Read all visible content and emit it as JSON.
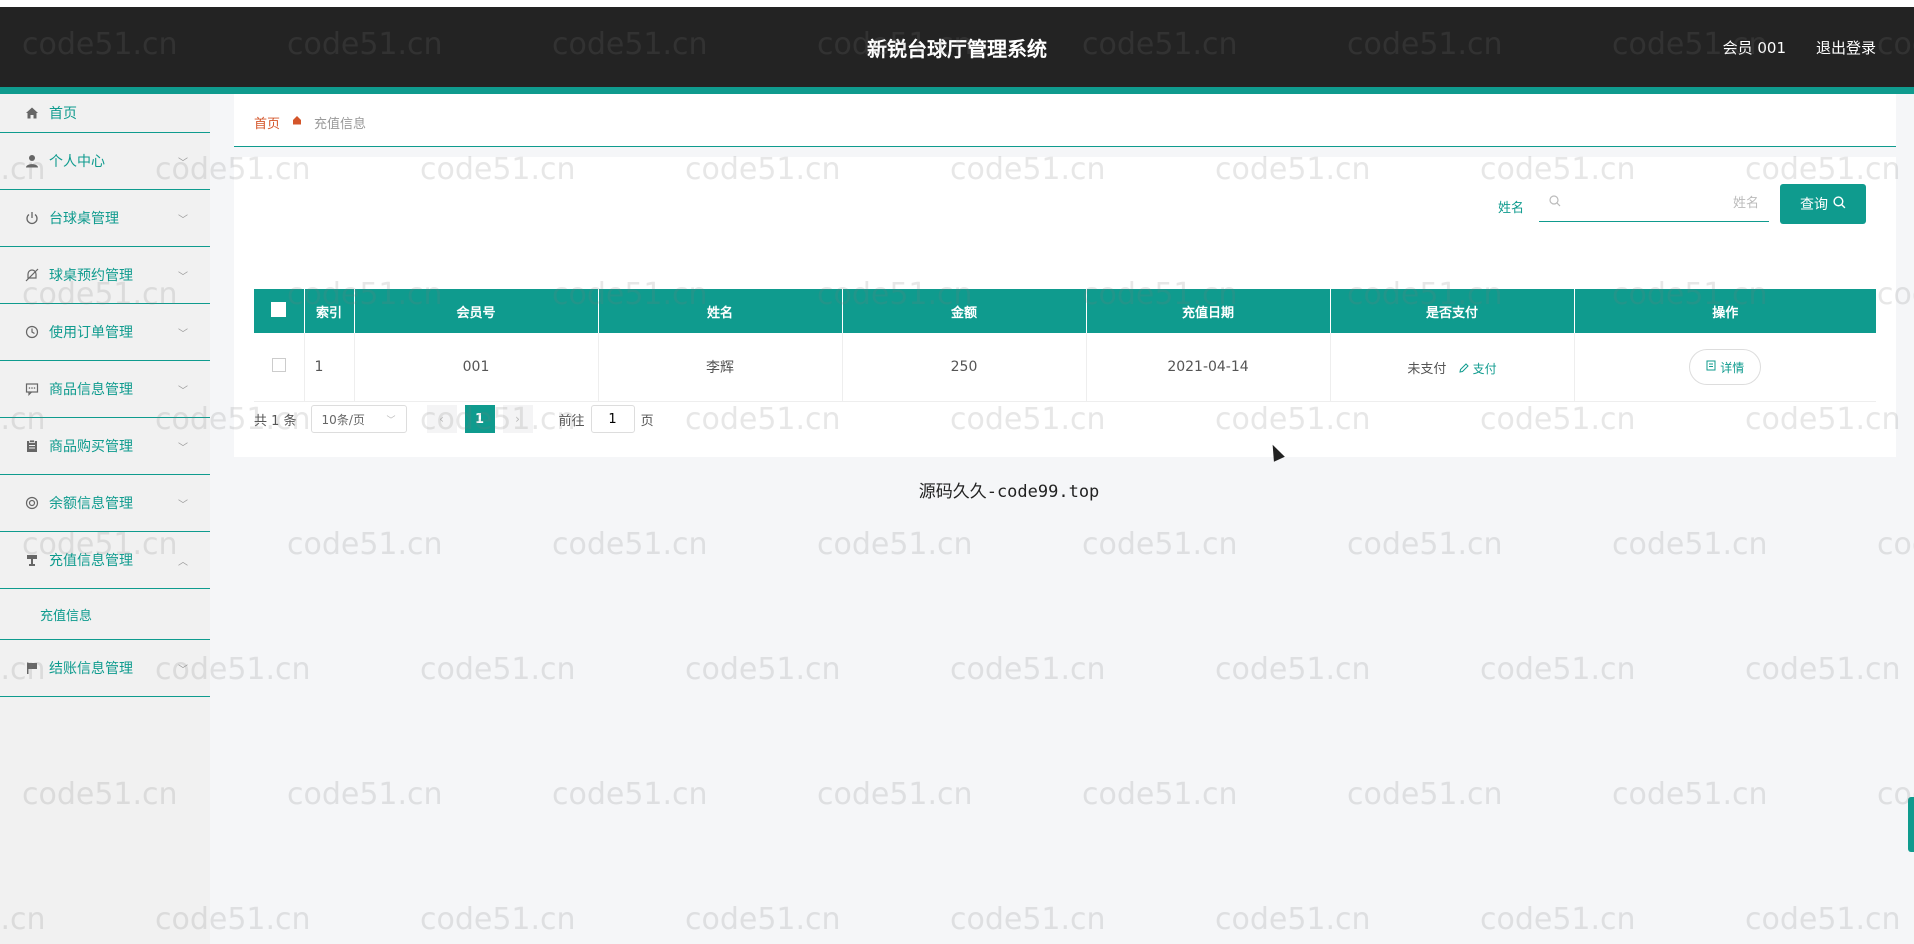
{
  "header": {
    "title": "新锐台球厅管理系统",
    "user": "会员 001",
    "logout": "退出登录"
  },
  "sidebar": {
    "items": [
      {
        "label": "首页",
        "icon": "home-icon"
      },
      {
        "label": "个人中心",
        "icon": "user-icon"
      },
      {
        "label": "台球桌管理",
        "icon": "power-icon"
      },
      {
        "label": "球桌预约管理",
        "icon": "bell-off-icon"
      },
      {
        "label": "使用订单管理",
        "icon": "clock-icon"
      },
      {
        "label": "商品信息管理",
        "icon": "chat-icon"
      },
      {
        "label": "商品购买管理",
        "icon": "clipboard-icon"
      },
      {
        "label": "余额信息管理",
        "icon": "wallet-icon"
      },
      {
        "label": "充值信息管理",
        "icon": "stand-icon"
      },
      {
        "label": "结账信息管理",
        "icon": "flag-icon"
      }
    ],
    "subitem": "充值信息"
  },
  "breadcrumb": {
    "home": "首页",
    "current": "充值信息"
  },
  "search": {
    "label": "姓名",
    "placeholder": "姓名",
    "button": "查询"
  },
  "table": {
    "headers": [
      "索引",
      "会员号",
      "姓名",
      "金额",
      "充值日期",
      "是否支付",
      "操作"
    ],
    "rows": [
      {
        "index": "1",
        "member_no": "001",
        "name": "李辉",
        "amount": "250",
        "date": "2021-04-14",
        "paid": "未支付",
        "pay_action": "支付",
        "detail": "详情"
      }
    ]
  },
  "pagination": {
    "total": "共 1 条",
    "page_size": "10条/页",
    "current_page": "1",
    "goto_label": "前往",
    "goto_value": "1",
    "page_suffix": "页"
  },
  "footer_note": "源码久久-code99.top",
  "watermark": "code51.cn",
  "colors": {
    "accent": "#0f9b8e",
    "header_bg": "#232323",
    "breadcrumb_home": "#d4552a"
  }
}
